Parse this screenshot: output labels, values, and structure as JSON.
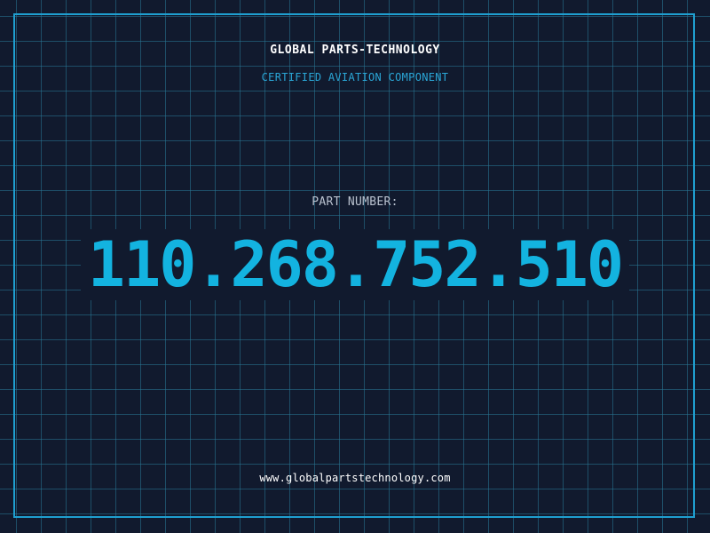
{
  "header": {
    "company": "GLOBAL PARTS-TECHNOLOGY",
    "subtitle": "CERTIFIED AVIATION COMPONENT"
  },
  "part": {
    "label": "PART NUMBER:",
    "number": "110.268.752.510"
  },
  "footer": {
    "website": "www.globalpartstechnology.com"
  },
  "colors": {
    "background": "#111a2e",
    "grid": "#287896",
    "frame": "#1f9fd0",
    "accent": "#13b3e0",
    "subtitle": "#2aa6d6",
    "label": "#b9c2cf",
    "text": "#ffffff"
  }
}
